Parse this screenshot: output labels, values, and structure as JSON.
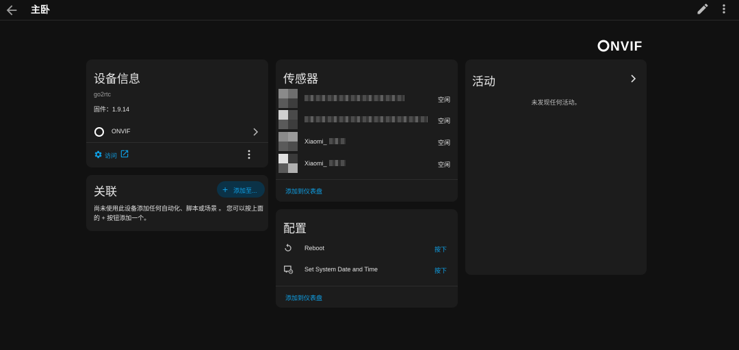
{
  "header": {
    "title": "主卧"
  },
  "brand": {
    "accent": "#0fa0e6"
  },
  "device_info": {
    "title": "设备信息",
    "model": "go2rtc",
    "firmware": "固件：1.9.14",
    "integration": "ONVIF",
    "visit": "访问"
  },
  "related": {
    "title": "关联",
    "add_button": "添加至...",
    "text": "尚未使用此设备添加任何自动化、脚本或场景 。 您可以按上面的 + 按钮添加一个。"
  },
  "sensors": {
    "title": "传感器",
    "items": [
      {
        "name": "",
        "state": "空闲"
      },
      {
        "name": "",
        "state": "空闲"
      },
      {
        "name": "Xiaomi_",
        "state": "空闲"
      },
      {
        "name": "Xiaomi_",
        "state": "空闲"
      }
    ],
    "add_to_dashboard": "添加到仪表盘"
  },
  "config": {
    "title": "配置",
    "items": [
      {
        "name": "Reboot",
        "action": "按下",
        "icon": "restart-icon"
      },
      {
        "name": "Set System Date and Time",
        "action": "按下",
        "icon": "monitor-clock-icon"
      }
    ],
    "add_to_dashboard": "添加到仪表盘"
  },
  "activity": {
    "title": "活动",
    "empty": "未发现任何活动。"
  }
}
